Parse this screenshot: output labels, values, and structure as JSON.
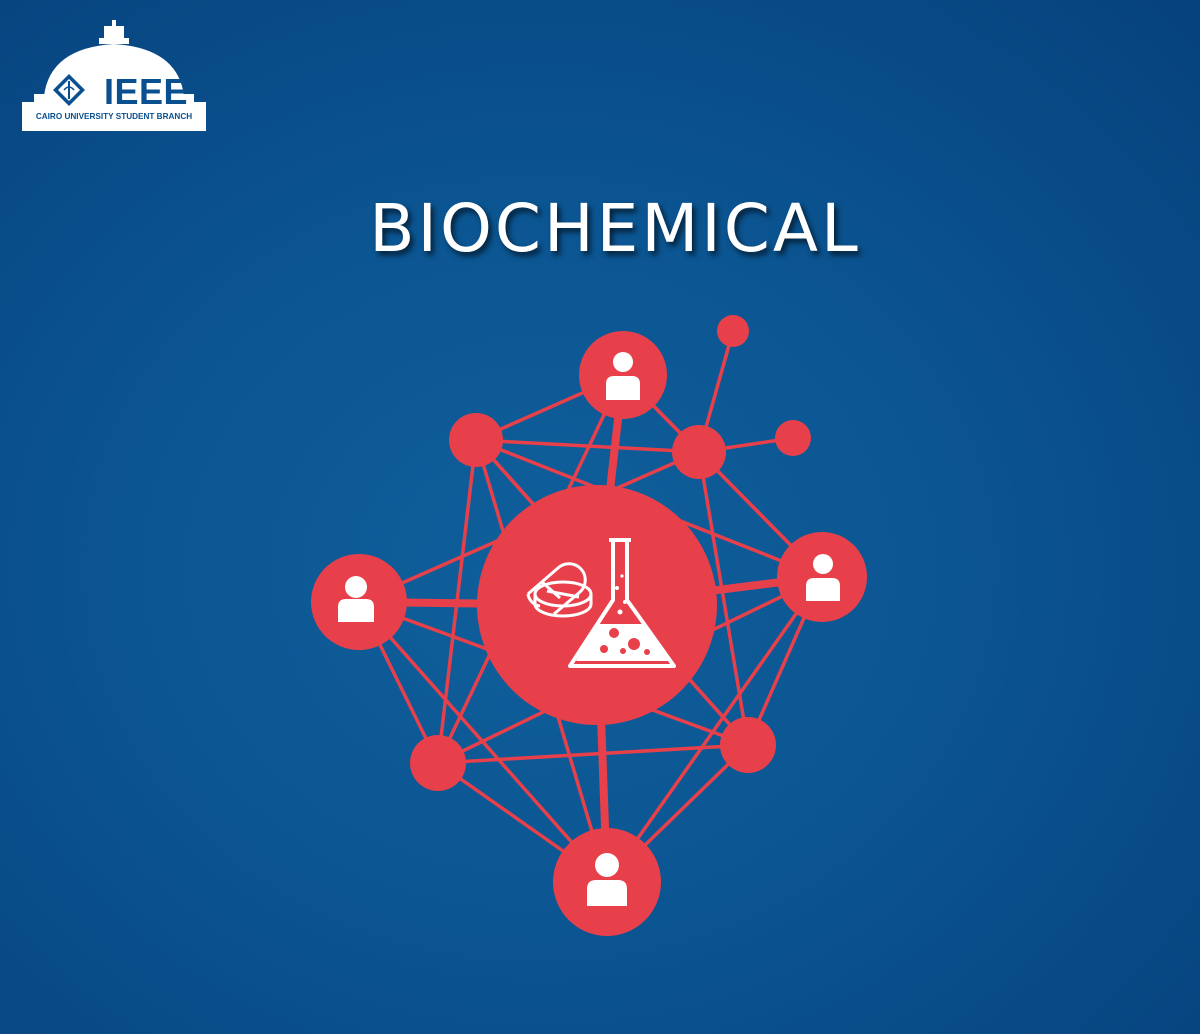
{
  "logo": {
    "wordmark": "IEEE",
    "subtitle": "CAIRO UNIVERSITY STUDENT BRANCH"
  },
  "title": "BIOCHEMICAL",
  "colors": {
    "background": "#0b5592",
    "node": "#e8404a",
    "icon": "#ffffff",
    "logo_blue": "#0a4f8f"
  },
  "icons": {
    "center": [
      "pill-capsule-icon",
      "pill-tablet-icon",
      "flask-icon"
    ],
    "people": "person-icon"
  }
}
